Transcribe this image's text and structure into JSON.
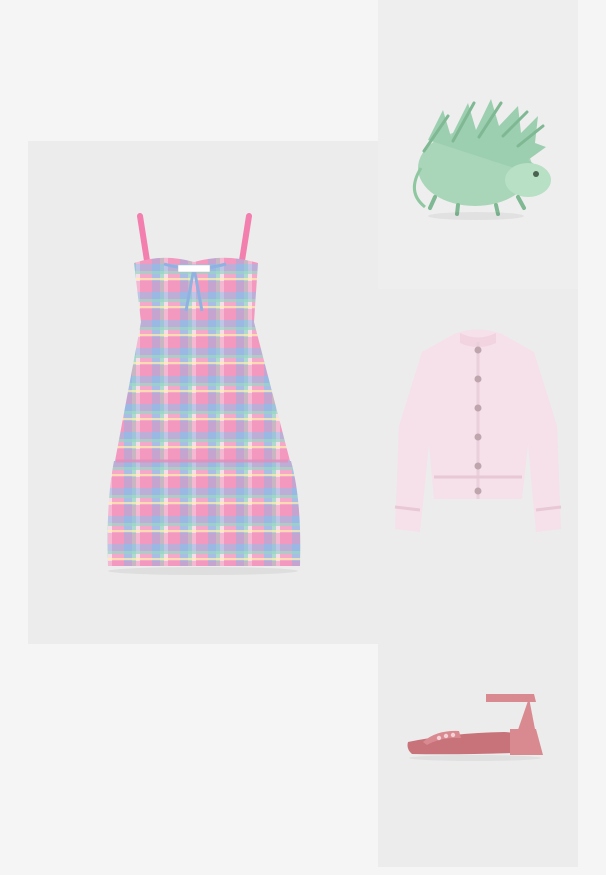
{
  "products": [
    {
      "id": "dress",
      "icon": "plaid-dress-image",
      "bg": "#ececec",
      "colors": [
        "#f27fae",
        "#8fb2e3",
        "#96d8c4",
        "#f4d9e9"
      ]
    },
    {
      "id": "bag",
      "icon": "hedgehog-bag-image",
      "bg": "#eeeeee",
      "colors": [
        "#a9d6b8",
        "#7fb893"
      ]
    },
    {
      "id": "cardigan",
      "icon": "pink-cardigan-image",
      "bg": "#ececec",
      "colors": [
        "#f6e0ea",
        "#d9a9bc"
      ]
    },
    {
      "id": "sandal",
      "icon": "pink-sandal-image",
      "bg": "#ececec",
      "colors": [
        "#d98a90",
        "#c8727a"
      ]
    }
  ]
}
